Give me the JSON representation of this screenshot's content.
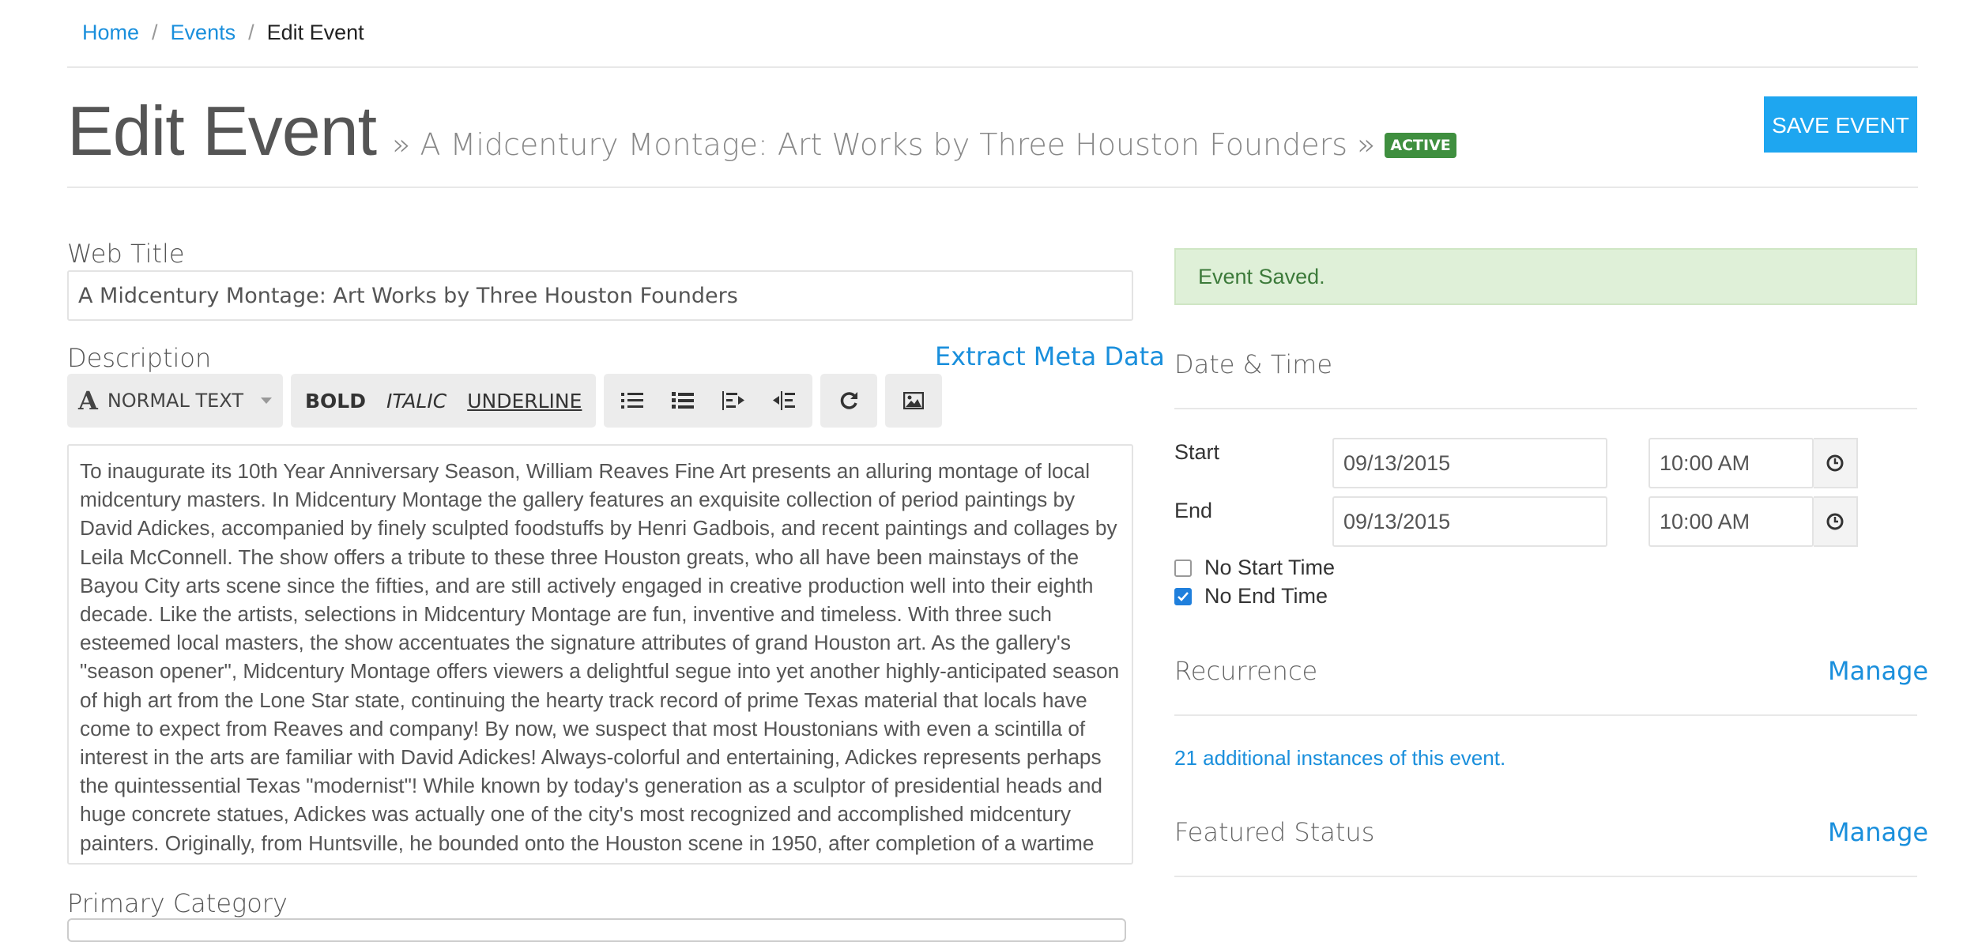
{
  "breadcrumb": {
    "home": "Home",
    "sep": "/",
    "events": "Events",
    "current": "Edit Event"
  },
  "header": {
    "title": "Edit Event",
    "subtitle": "» A Midcentury Montage: Art Works by Three Houston Founders »",
    "status_badge": "ACTIVE",
    "save_button": "SAVE EVENT"
  },
  "form": {
    "web_title_label": "Web Title",
    "web_title_value": "A Midcentury Montage: Art Works by Three Houston Founders",
    "description_label": "Description",
    "extract_meta": "Extract Meta Data",
    "toolbar": {
      "text_style": "NORMAL TEXT",
      "bold": "BOLD",
      "italic": "ITALIC",
      "underline": "UNDERLINE",
      "font_glyph": "A",
      "icons": [
        "unordered-list-icon",
        "ordered-list-icon",
        "outdent-icon",
        "indent-icon",
        "redo-icon",
        "image-icon"
      ]
    },
    "description_text": "To inaugurate its 10th Year Anniversary Season, William Reaves Fine Art presents an alluring montage of local midcentury masters. In Midcentury Montage the gallery features an exquisite collection of period paintings by David Adickes, accompanied by finely sculpted foodstuffs by Henri Gadbois, and recent paintings and collages by Leila McConnell. The show offers a tribute to these three Houston greats, who all have been mainstays of the Bayou City arts scene since the fifties, and are still actively engaged in creative production well into their eighth decade. Like the artists, selections in Midcentury Montage are fun, inventive and timeless. With three such esteemed local masters, the show accentuates the signature attributes of grand Houston art. As the gallery's \"season opener\", Midcentury Montage offers viewers a delightful segue into yet another highly-anticipated season of high art from the Lone Star state, continuing the hearty track record of prime Texas material that locals have come to expect from Reaves and company! By now, we suspect that most Houstonians with even a scintilla of interest in the arts are familiar with David Adickes! Always-colorful and entertaining, Adickes represents perhaps the quintessential Texas \"modernist\"! While known by today's generation as a sculptor of presidential heads and huge concrete statues, Adickes was actually one of the city's most recognized and accomplished midcentury painters. Originally, from Huntsville, he bounded onto the Houston scene in 1950, after completion of a wartime",
    "primary_category_label": "Primary Category"
  },
  "sidebar": {
    "alert": "Event Saved.",
    "date_time_title": "Date & Time",
    "start_label": "Start",
    "start_date": "09/13/2015",
    "start_time": "10:00 AM",
    "end_label": "End",
    "end_date": "09/13/2015",
    "end_time": "10:00 AM",
    "no_start_time": "No Start Time",
    "no_end_time": "No End Time",
    "no_start_checked": false,
    "no_end_checked": true,
    "recurrence_title": "Recurrence",
    "manage": "Manage",
    "instances_link": "21 additional instances of this event.",
    "featured_title": "Featured Status"
  },
  "colors": {
    "accent": "#1ea6f0",
    "link": "#1a8fdc",
    "badge": "#3f8f3f",
    "alert_bg": "#dff0d8"
  }
}
